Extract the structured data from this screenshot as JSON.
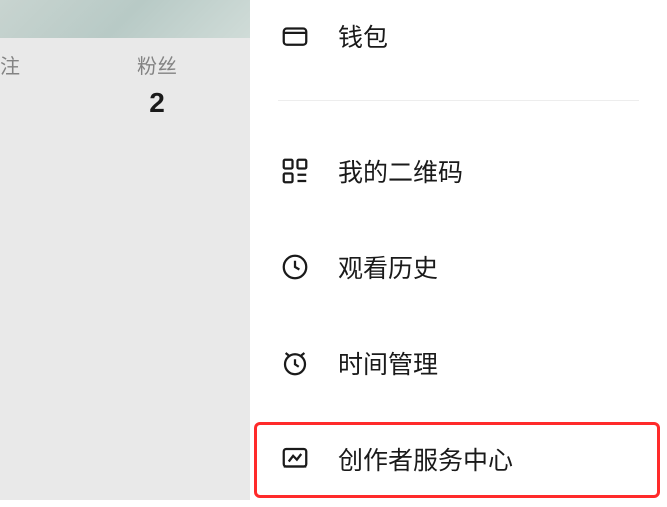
{
  "stats": {
    "following_label": "注",
    "followers_label": "粉丝",
    "followers_count": "2"
  },
  "menu": {
    "wallet": "钱包",
    "qrcode": "我的二维码",
    "history": "观看历史",
    "time": "时间管理",
    "creator": "创作者服务中心"
  }
}
